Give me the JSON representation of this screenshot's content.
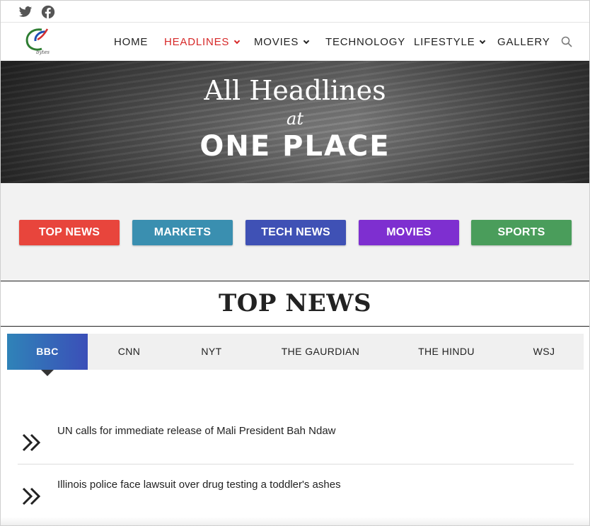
{
  "social": {
    "icons": [
      "twitter-icon",
      "facebook-icon"
    ],
    "icon_color": "#555555"
  },
  "header": {
    "logo_text": "bytes",
    "nav": [
      {
        "label": "HOME",
        "dropdown": false,
        "active": false
      },
      {
        "label": "HEADLINES",
        "dropdown": true,
        "active": true
      },
      {
        "label": "MOVIES",
        "dropdown": true,
        "active": false
      },
      {
        "label": "TECHNOLOGY",
        "dropdown": false,
        "active": false
      },
      {
        "label": "LIFESTYLE",
        "dropdown": true,
        "active": false
      },
      {
        "label": "GALLERY",
        "dropdown": false,
        "active": false
      }
    ],
    "active_color": "#d62828"
  },
  "hero": {
    "line1": "All Headlines",
    "line2": "at",
    "line3": "ONE PLACE"
  },
  "categories": [
    {
      "label": "TOP NEWS",
      "color": "#e8453c"
    },
    {
      "label": "MARKETS",
      "color": "#3a8fb0"
    },
    {
      "label": "TECH NEWS",
      "color": "#3f51b5"
    },
    {
      "label": "MOVIES",
      "color": "#7e2fd0"
    },
    {
      "label": "SPORTS",
      "color": "#4a9d5b"
    }
  ],
  "section": {
    "title": "TOP NEWS"
  },
  "tabs": [
    {
      "label": "BBC",
      "active": true
    },
    {
      "label": "CNN",
      "active": false
    },
    {
      "label": "NYT",
      "active": false
    },
    {
      "label": "THE GAURDIAN",
      "active": false
    },
    {
      "label": "THE HINDU",
      "active": false
    },
    {
      "label": "WSJ",
      "active": false
    }
  ],
  "news": [
    {
      "headline": "UN calls for immediate release of Mali President Bah Ndaw"
    },
    {
      "headline": "Illinois police face lawsuit over drug testing a toddler's ashes"
    }
  ]
}
